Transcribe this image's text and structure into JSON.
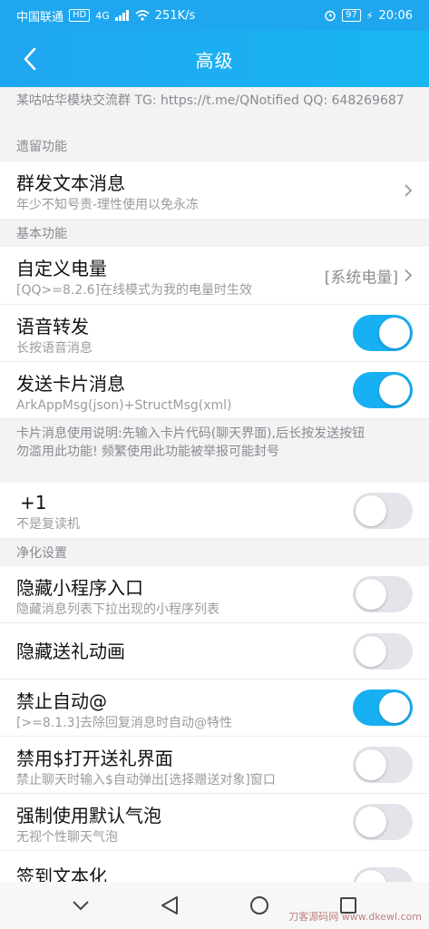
{
  "status_bar": {
    "carrier": "中国联通",
    "hd": "HD",
    "net": "4G",
    "speed": "251K/s",
    "battery": "97",
    "time": "20:06"
  },
  "header": {
    "title": "高级"
  },
  "notice_top": "某咕咕华模块交流群 TG: https://t.me/QNotified QQ: 648269687",
  "sections": {
    "legacy": "遗留功能",
    "basic": "基本功能",
    "purify": "净化设置"
  },
  "items": {
    "mass_text": {
      "title": "群发文本消息",
      "sub": "年少不知号贵-理性使用以免永冻"
    },
    "battery": {
      "title": "自定义电量",
      "sub": "[QQ>=8.2.6]在线模式为我的电量时生效",
      "value": "[系统电量]"
    },
    "voice_forward": {
      "title": "语音转发",
      "sub": "长按语音消息",
      "on": true
    },
    "card_msg": {
      "title": "发送卡片消息",
      "sub": "ArkAppMsg(json)+StructMsg(xml)",
      "on": true
    },
    "plus_one": {
      "title": "+1",
      "sub": "不是复读机",
      "on": false
    },
    "hide_mini": {
      "title": "隐藏小程序入口",
      "sub": "隐藏消息列表下拉出现的小程序列表",
      "on": false
    },
    "hide_gift": {
      "title": "隐藏送礼动画",
      "on": false
    },
    "no_auto_at": {
      "title": "禁止自动@",
      "sub": "[>=8.1.3]去除回复消息时自动@特性",
      "on": true
    },
    "no_gift_ui": {
      "title": "禁用$打开送礼界面",
      "sub": "禁止聊天时输入$自动弹出[选择赠送对象]窗口",
      "on": false
    },
    "default_bubble": {
      "title": "强制使用默认气泡",
      "sub": "无视个性聊天气泡",
      "on": false
    },
    "sign_text": {
      "title": "签到文本化",
      "on": false
    }
  },
  "card_notice_1": "卡片消息使用说明:先输入卡片代码(聊天界面),后长按发送按钮",
  "card_notice_2": "勿滥用此功能! 频繁使用此功能被举报可能封号",
  "watermark": "刀客源码网 www.dkewl.com",
  "colors": {
    "accent": "#17b0f2",
    "header": "#1fa6f0",
    "toggle_off": "#e4e4ea"
  }
}
